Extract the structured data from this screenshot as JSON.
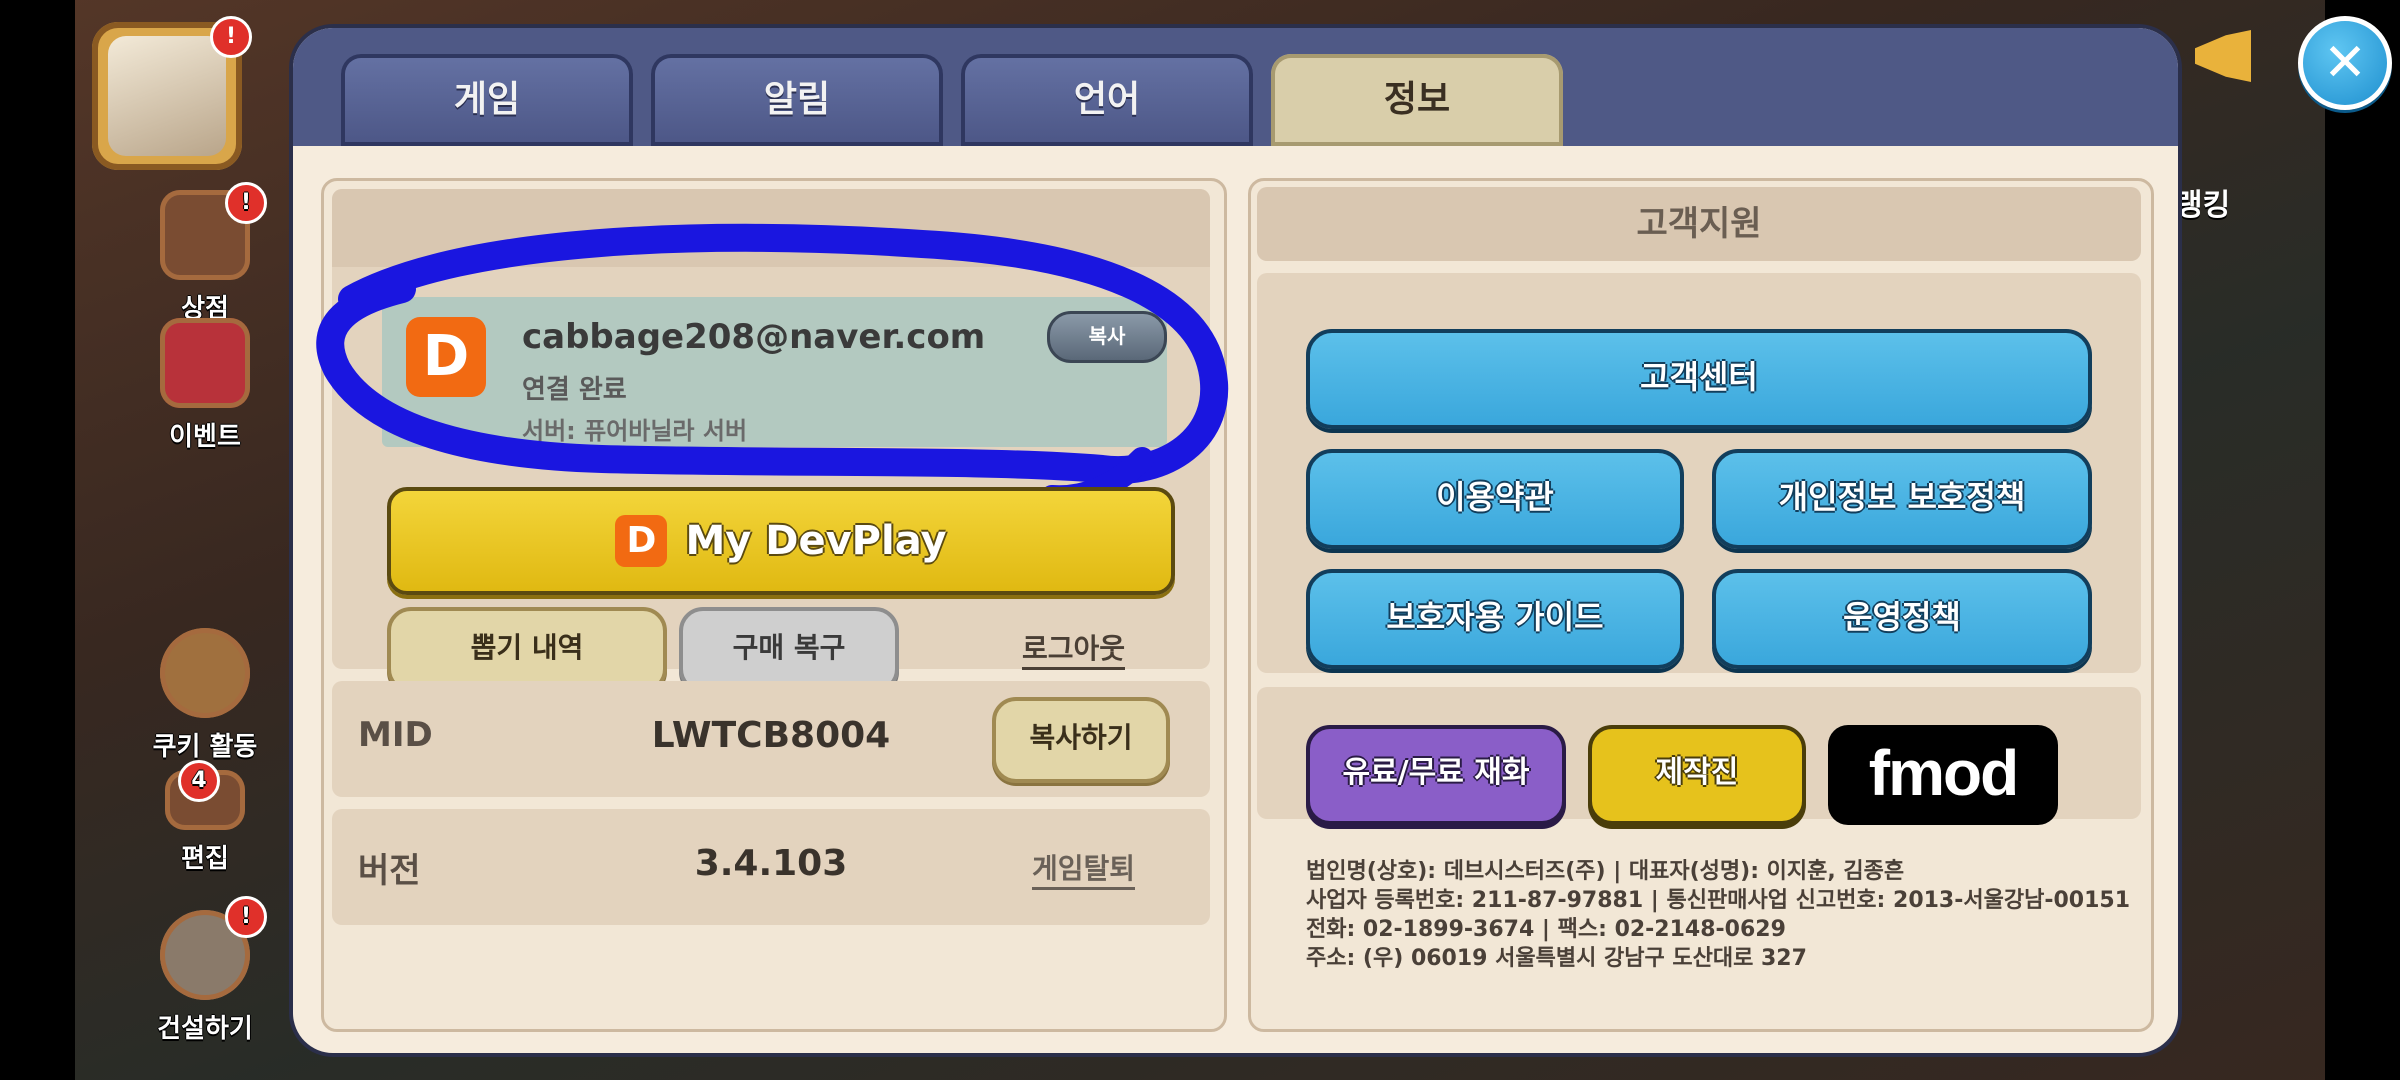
{
  "background": {
    "side_menu": [
      {
        "label": "상점",
        "badge": "!"
      },
      {
        "label": "이벤트",
        "badge": ""
      },
      {
        "label": "쿠키 활동",
        "badge": ""
      },
      {
        "label": "편집",
        "badge": "4"
      },
      {
        "label": "건설하기",
        "badge": "!"
      }
    ],
    "avatar_badge": "!",
    "right_label": "랭킹"
  },
  "tabs": [
    {
      "label": "게임",
      "active": false
    },
    {
      "label": "알림",
      "active": false
    },
    {
      "label": "언어",
      "active": false
    },
    {
      "label": "정보",
      "active": true
    }
  ],
  "account": {
    "logo_letter": "D",
    "email": "cabbage208@naver.com",
    "status": "연결 완료",
    "server": "서버: 퓨어바닐라 서버",
    "copy_label": "복사",
    "devplay_label": "My DevPlay",
    "history_label": "뽑기 내역",
    "restore_label": "구매 복구",
    "logout_label": "로그아웃"
  },
  "mid": {
    "label": "MID",
    "value": "LWTCB8004",
    "copy_label": "복사하기"
  },
  "version": {
    "label": "버전",
    "value": "3.4.103",
    "withdraw_label": "게임탈퇴"
  },
  "support": {
    "title": "고객지원",
    "customer_center": "고객센터",
    "terms": "이용약관",
    "privacy": "개인정보 보호정책",
    "guardian_guide": "보호자용 가이드",
    "operation_policy": "운영정책",
    "currency": "유료/무료 재화",
    "credits": "제작진",
    "fmod": "fmod"
  },
  "company_info": [
    "법인명(상호): 데브시스터즈(주) | 대표자(성명): 이지훈, 김종흔",
    "사업자 등록번호: 211-87-97881 | 통신판매사업 신고번호: 2013-서울강남-00151",
    "전화: 02-1899-3674 | 팩스: 02-2148-0629",
    "주소: (우) 06019 서울특별시 강남구 도산대로 327"
  ],
  "colors": {
    "tab_bar": "#4f5986",
    "active_tab": "#d9ceaa",
    "scribble": "#1a16e0",
    "blue_button": "#3aa7dc",
    "devplay_yellow": "#e0b912",
    "devplay_orange": "#f26a12"
  },
  "icons": {
    "close": "close-icon",
    "megaphone": "megaphone-icon"
  }
}
